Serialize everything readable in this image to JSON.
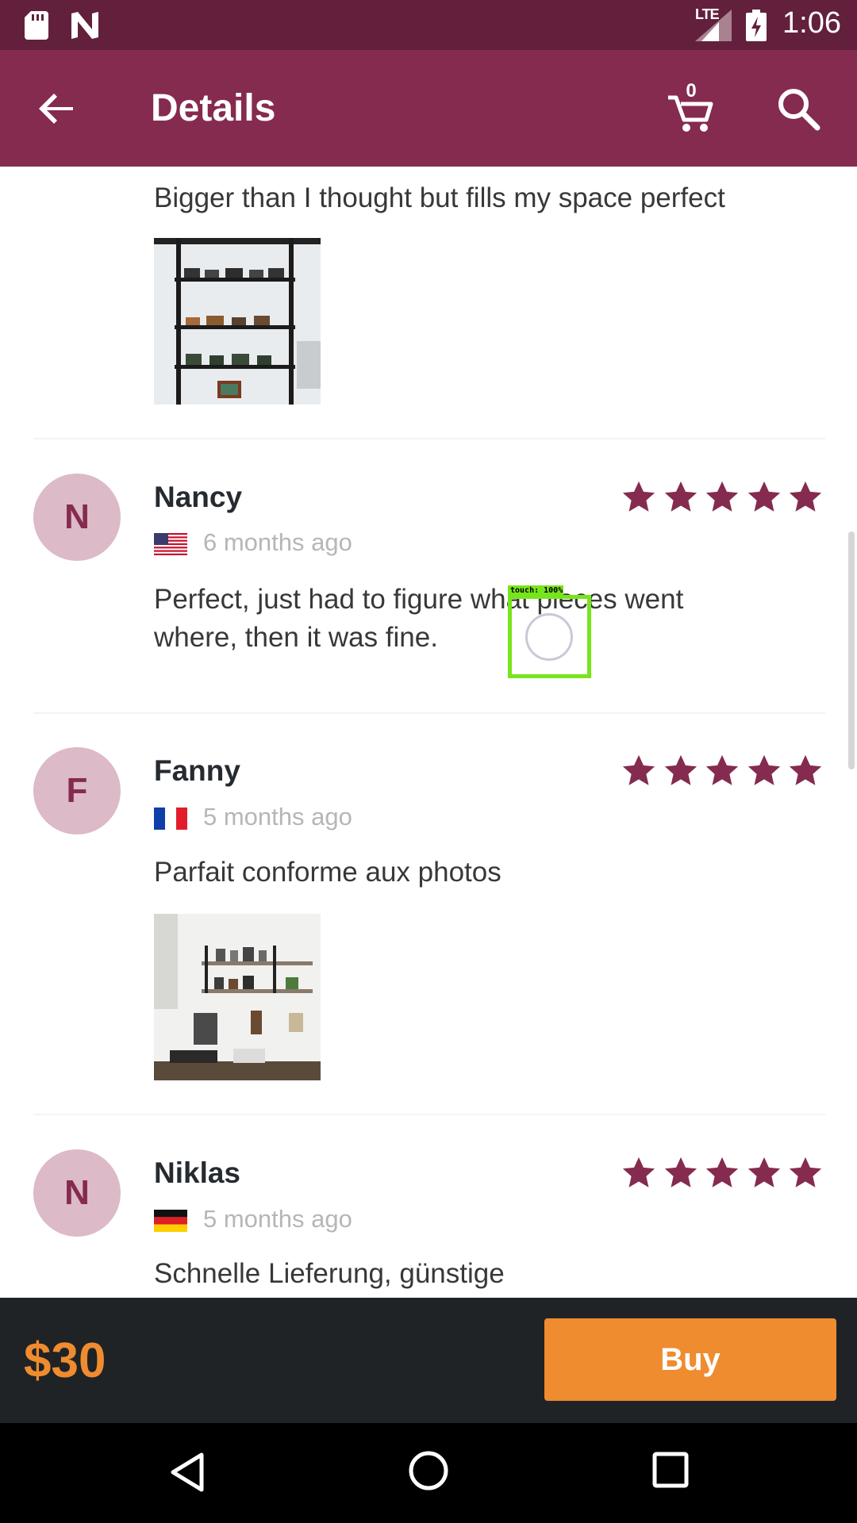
{
  "status_bar": {
    "network": "LTE",
    "time": "1:06"
  },
  "app_bar": {
    "title": "Details",
    "cart_count": "0"
  },
  "reviews": [
    {
      "text": "Bigger than I thought but fills my space perfect",
      "has_photo": true
    },
    {
      "initial": "N",
      "name": "Nancy",
      "country": "United States",
      "date": "6 months ago",
      "rating": 5,
      "text_line1": "Perfect, just had to figure what pieces went",
      "text_line2": "where, then it was fine."
    },
    {
      "initial": "F",
      "name": "Fanny",
      "country": "France",
      "date": "5 months ago",
      "rating": 5,
      "text": "Parfait conforme aux photos",
      "has_photo": true
    },
    {
      "initial": "N",
      "name": "Niklas",
      "country": "Germany",
      "date": "5 months ago",
      "rating": 5,
      "text": "Schnelle Lieferung, günstige"
    }
  ],
  "touch_overlay": {
    "label": "touch: 100%"
  },
  "buy_bar": {
    "price": "$30",
    "buy_label": "Buy"
  },
  "colors": {
    "status_bar": "#62203d",
    "app_bar": "#852b4f",
    "star": "#852b4f",
    "accent": "#ef8c2f",
    "avatar_bg": "#dcbac7"
  },
  "icons": [
    "sd-card-icon",
    "n-notification-icon",
    "signal-icon",
    "battery-charging-icon",
    "back-arrow-icon",
    "cart-icon",
    "search-icon",
    "star-icon",
    "nav-back-icon",
    "nav-home-icon",
    "nav-recents-icon"
  ]
}
